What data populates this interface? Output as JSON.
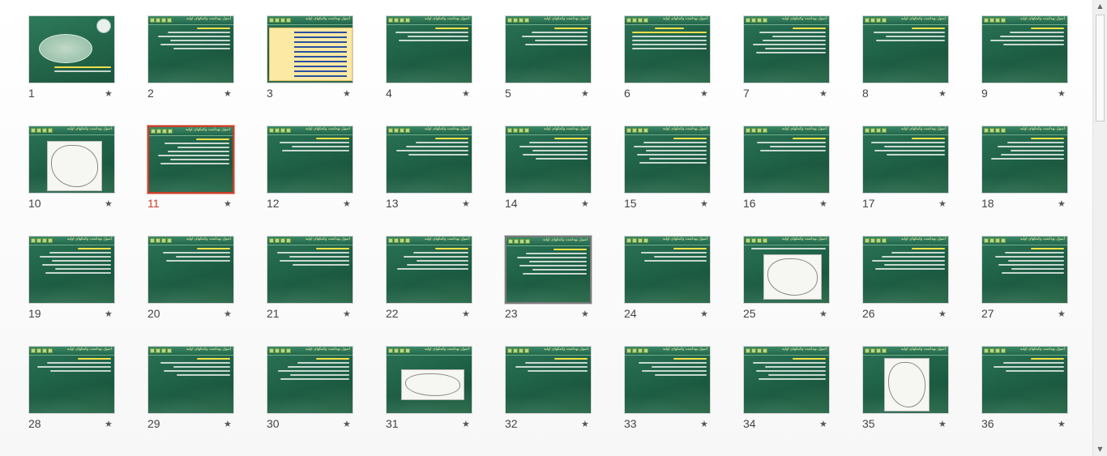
{
  "slide_header_title": "اصول بهداشت وکمکهای اولیه",
  "title_slide": {
    "title_lines": [
      "اصول بهداشت",
      "و",
      "کمک های اولیه"
    ],
    "presenter": "تهیه کننده : دکتر محمد علی ابراهیمی"
  },
  "slide2_subtitle": "فصل اول",
  "current_slide": 11,
  "hovered_slide": 23,
  "star_glyph": "★",
  "scrollbar": {
    "up_glyph": "▲",
    "down_glyph": "▼"
  },
  "colors": {
    "selection": "#c8402a",
    "slide_bg": "#1f6247"
  },
  "slides": [
    {
      "num": "1",
      "type": "title"
    },
    {
      "num": "2",
      "type": "text"
    },
    {
      "num": "3",
      "type": "toc"
    },
    {
      "num": "4",
      "type": "text"
    },
    {
      "num": "5",
      "type": "text"
    },
    {
      "num": "6",
      "type": "chapter"
    },
    {
      "num": "7",
      "type": "text"
    },
    {
      "num": "8",
      "type": "text"
    },
    {
      "num": "9",
      "type": "text"
    },
    {
      "num": "10",
      "type": "image"
    },
    {
      "num": "11",
      "type": "text"
    },
    {
      "num": "12",
      "type": "text"
    },
    {
      "num": "13",
      "type": "text"
    },
    {
      "num": "14",
      "type": "text"
    },
    {
      "num": "15",
      "type": "text"
    },
    {
      "num": "16",
      "type": "text"
    },
    {
      "num": "17",
      "type": "text"
    },
    {
      "num": "18",
      "type": "text"
    },
    {
      "num": "19",
      "type": "text"
    },
    {
      "num": "20",
      "type": "text"
    },
    {
      "num": "21",
      "type": "text"
    },
    {
      "num": "22",
      "type": "text"
    },
    {
      "num": "23",
      "type": "text"
    },
    {
      "num": "24",
      "type": "text"
    },
    {
      "num": "25",
      "type": "image"
    },
    {
      "num": "26",
      "type": "text"
    },
    {
      "num": "27",
      "type": "text"
    },
    {
      "num": "28",
      "type": "text"
    },
    {
      "num": "29",
      "type": "text"
    },
    {
      "num": "30",
      "type": "text"
    },
    {
      "num": "31",
      "type": "image"
    },
    {
      "num": "32",
      "type": "text"
    },
    {
      "num": "33",
      "type": "text"
    },
    {
      "num": "34",
      "type": "text"
    },
    {
      "num": "35",
      "type": "image"
    },
    {
      "num": "36",
      "type": "text"
    }
  ]
}
